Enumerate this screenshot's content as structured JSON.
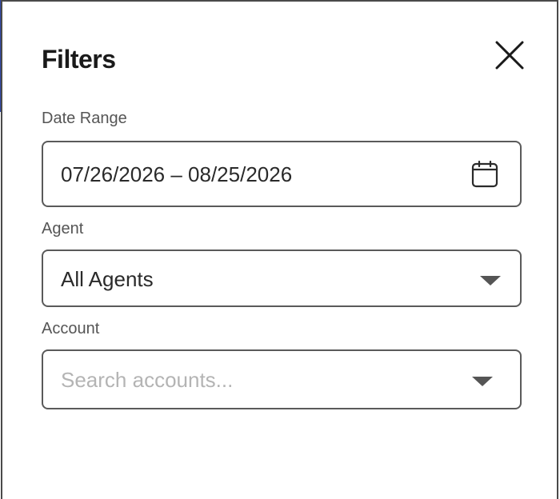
{
  "panel": {
    "title": "Filters"
  },
  "date_range": {
    "label": "Date Range",
    "value": "07/26/2026 – 08/25/2026",
    "icon": "calendar-icon"
  },
  "agent": {
    "label": "Agent",
    "selected": "All Agents",
    "icon": "chevron-down-icon"
  },
  "account": {
    "label": "Account",
    "placeholder": "Search accounts...",
    "icon": "chevron-down-icon"
  },
  "colors": {
    "border": "#5a5a5a",
    "accent": "#2f46a8",
    "placeholder": "#b4b4b4"
  }
}
